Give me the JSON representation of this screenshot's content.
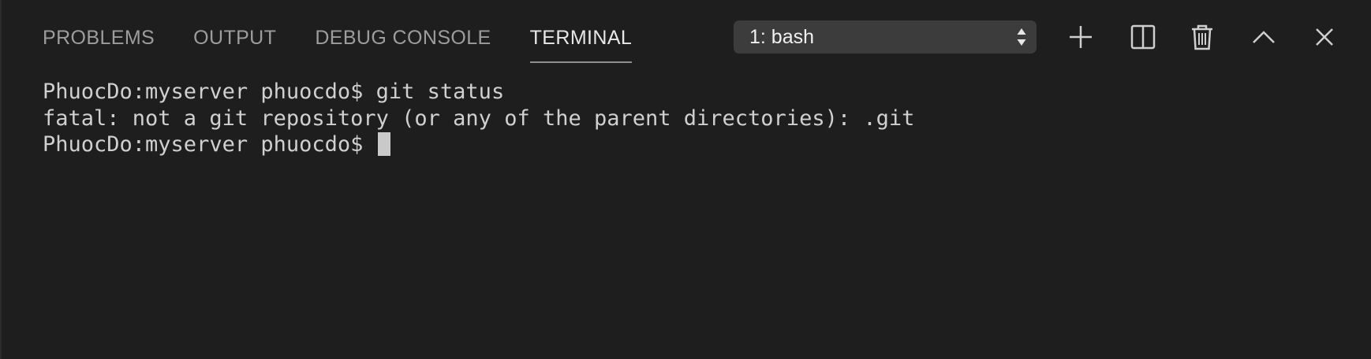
{
  "tabs": [
    {
      "label": "PROBLEMS",
      "active": false
    },
    {
      "label": "OUTPUT",
      "active": false
    },
    {
      "label": "DEBUG CONSOLE",
      "active": false
    },
    {
      "label": "TERMINAL",
      "active": true
    }
  ],
  "terminal_select": {
    "selected": "1: bash"
  },
  "toolbar": {
    "icons": [
      "plus-icon",
      "split-icon",
      "trash-icon",
      "chevron-up-icon",
      "close-icon"
    ]
  },
  "terminal": {
    "line1_prompt": "PhuocDo:myserver phuocdo$ ",
    "line1_command": "git status",
    "line2_output": "fatal: not a git repository (or any of the parent directories): .git",
    "line3_prompt": "PhuocDo:myserver phuocdo$ "
  },
  "colors": {
    "background": "#1e1e1e",
    "tab_inactive": "#9d9d9d",
    "tab_active": "#e7e7e7",
    "select_bg": "#3c3c3c",
    "terminal_text": "#d0d0d0",
    "cursor": "#c9c9c9"
  }
}
